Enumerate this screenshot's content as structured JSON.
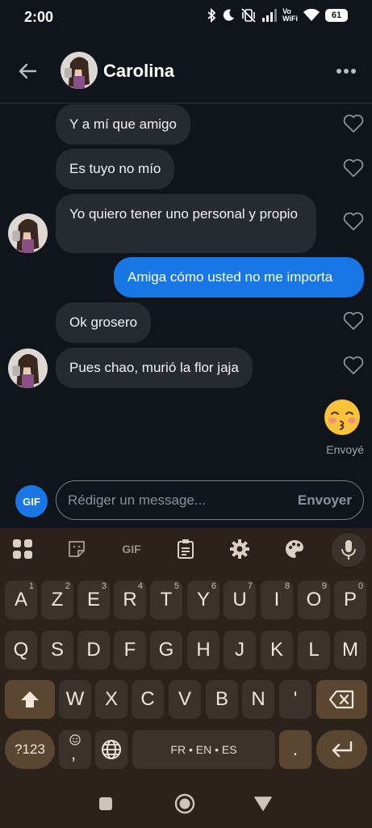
{
  "status_bar": {
    "time": "2:00",
    "vowifi_line1": "Vo",
    "vowifi_line2": "WiFi",
    "battery": "61"
  },
  "header": {
    "contact_name": "Carolina"
  },
  "messages": [
    {
      "text": "Y a mí que amigo",
      "direction": "in"
    },
    {
      "text": "Es tuyo no mío",
      "direction": "in"
    },
    {
      "text": "Yo quiero tener uno personal y propio",
      "direction": "in"
    },
    {
      "text": "Amiga cómo usted no me importa",
      "direction": "out"
    },
    {
      "text": "Ok grosero",
      "direction": "in"
    },
    {
      "text": "Pues chao, murió la flor jaja",
      "direction": "in"
    }
  ],
  "last_sent": {
    "emoji": "kissing-face-with-closed-eyes",
    "status": "Envoyé"
  },
  "composer": {
    "gif_label": "GIF",
    "placeholder": "Rédiger un message...",
    "send_label": "Envoyer"
  },
  "keyboard": {
    "toolbar": {
      "gif_label": "GIF"
    },
    "row1": [
      {
        "key": "A",
        "hint": "1"
      },
      {
        "key": "Z",
        "hint": "2"
      },
      {
        "key": "E",
        "hint": "3"
      },
      {
        "key": "R",
        "hint": "4"
      },
      {
        "key": "T",
        "hint": "5"
      },
      {
        "key": "Y",
        "hint": "6"
      },
      {
        "key": "U",
        "hint": "7"
      },
      {
        "key": "I",
        "hint": "8"
      },
      {
        "key": "O",
        "hint": "9"
      },
      {
        "key": "P",
        "hint": "0"
      }
    ],
    "row2": [
      "Q",
      "S",
      "D",
      "F",
      "G",
      "H",
      "J",
      "K",
      "L",
      "M"
    ],
    "row3": [
      "W",
      "X",
      "C",
      "V",
      "B",
      "N",
      "'"
    ],
    "symbols_key": "?123",
    "comma_key": ",",
    "space_label": "FR • EN • ES",
    "period_key": "."
  }
}
